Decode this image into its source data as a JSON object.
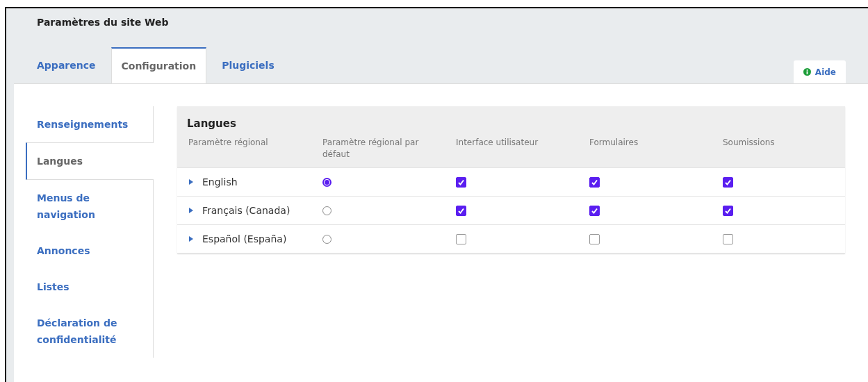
{
  "page_title": "Paramètres du site Web",
  "tabs": [
    {
      "label": "Apparence",
      "selected": false
    },
    {
      "label": "Configuration",
      "selected": true
    },
    {
      "label": "Plugiciels",
      "selected": false
    }
  ],
  "help_button": {
    "label": "Aide"
  },
  "sidebar": {
    "items": [
      {
        "label": "Renseignements",
        "selected": false
      },
      {
        "label": "Langues",
        "selected": true
      },
      {
        "label": "Menus de navigation",
        "selected": false
      },
      {
        "label": "Annonces",
        "selected": false
      },
      {
        "label": "Listes",
        "selected": false
      },
      {
        "label": "Déclaration de confidentialité",
        "selected": false
      }
    ]
  },
  "table": {
    "title": "Langues",
    "columns": [
      "Paramètre régional",
      "Paramètre régional par défaut",
      "Interface utilisateur",
      "Formulaires",
      "Soumissions"
    ],
    "rows": [
      {
        "locale": "English",
        "default_selected": true,
        "ui_checked": true,
        "forms_checked": true,
        "submissions_checked": true
      },
      {
        "locale": "Français (Canada)",
        "default_selected": false,
        "ui_checked": true,
        "forms_checked": true,
        "submissions_checked": true
      },
      {
        "locale": "Español (España)",
        "default_selected": false,
        "ui_checked": false,
        "forms_checked": false,
        "submissions_checked": false
      }
    ]
  }
}
